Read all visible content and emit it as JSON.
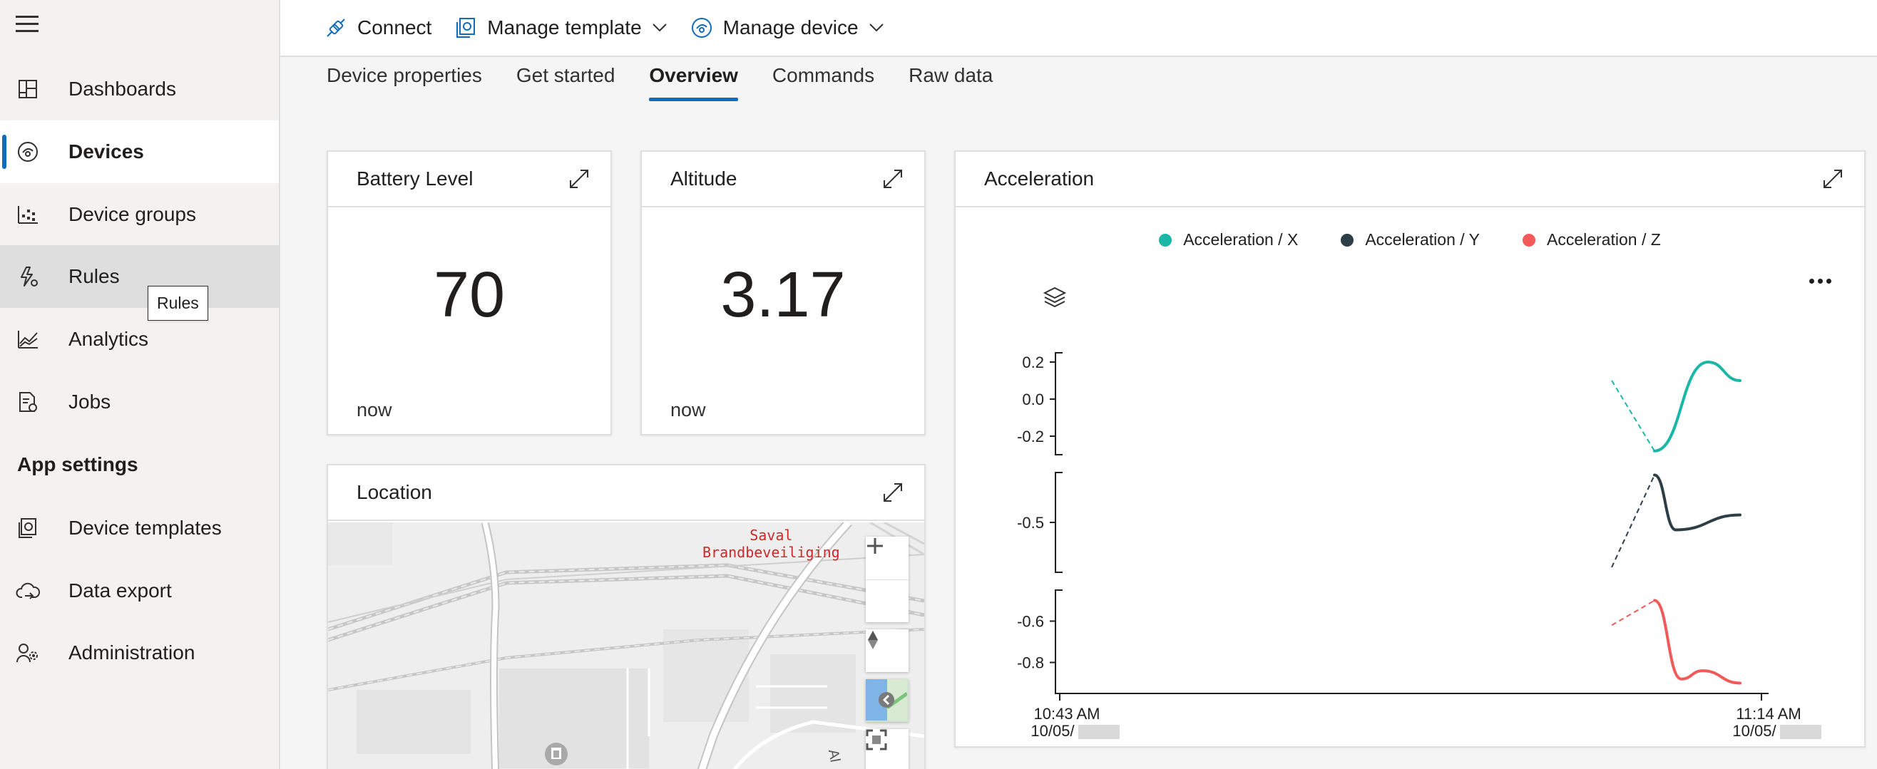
{
  "sidebar": {
    "items": [
      {
        "label": "Dashboards",
        "icon": "dashboard-icon"
      },
      {
        "label": "Devices",
        "icon": "devices-icon"
      },
      {
        "label": "Device groups",
        "icon": "device-groups-icon"
      },
      {
        "label": "Rules",
        "icon": "rules-icon"
      },
      {
        "label": "Analytics",
        "icon": "analytics-icon"
      },
      {
        "label": "Jobs",
        "icon": "jobs-icon"
      }
    ],
    "app_settings_title": "App settings",
    "settings_items": [
      {
        "label": "Device templates",
        "icon": "device-templates-icon"
      },
      {
        "label": "Data export",
        "icon": "data-export-icon"
      },
      {
        "label": "Administration",
        "icon": "administration-icon"
      }
    ],
    "tooltip": "Rules"
  },
  "toolbar": {
    "connect": "Connect",
    "manage_template": "Manage template",
    "manage_device": "Manage device"
  },
  "tabs": [
    "Device properties",
    "Get started",
    "Overview",
    "Commands",
    "Raw data"
  ],
  "active_tab": "Overview",
  "tiles": {
    "battery": {
      "title": "Battery Level",
      "value": "70",
      "time": "now"
    },
    "altitude": {
      "title": "Altitude",
      "value": "3.17",
      "time": "now"
    },
    "location": {
      "title": "Location",
      "map_label_line1": "Saval",
      "map_label_line2": "Brandbeveiliging",
      "road_label": "Al"
    },
    "acceleration": {
      "title": "Acceleration"
    }
  },
  "colors": {
    "accent": "#0f6cbd",
    "series_x": "#1ab7a6",
    "series_y": "#2d3e46",
    "series_z": "#f25a5a"
  },
  "chart_data": {
    "type": "line",
    "title": "Acceleration",
    "x_ticks": [
      {
        "time": "10:43 AM",
        "date": "10/05/"
      },
      {
        "time": "11:14 AM",
        "date": "10/05/"
      }
    ],
    "series": [
      {
        "name": "Acceleration / X",
        "yticks": [
          "0.2",
          "0.0",
          "-0.2"
        ],
        "ylim": [
          -0.3,
          0.25
        ],
        "points": [
          [
            0,
            0.1
          ],
          [
            0.08,
            -0.28
          ],
          [
            0.18,
            0.2
          ],
          [
            0.24,
            0.1
          ]
        ]
      },
      {
        "name": "Acceleration / Y",
        "yticks": [
          "-0.5"
        ],
        "ylim": [
          -0.7,
          -0.3
        ],
        "points": [
          [
            0,
            -0.68
          ],
          [
            0.08,
            -0.31
          ],
          [
            0.12,
            -0.53
          ],
          [
            0.24,
            -0.47
          ]
        ]
      },
      {
        "name": "Acceleration / Z",
        "yticks": [
          "-0.6",
          "-0.8"
        ],
        "ylim": [
          -0.95,
          -0.45
        ],
        "points": [
          [
            0,
            -0.62
          ],
          [
            0.08,
            -0.5
          ],
          [
            0.13,
            -0.88
          ],
          [
            0.17,
            -0.84
          ],
          [
            0.24,
            -0.9
          ]
        ]
      }
    ]
  }
}
